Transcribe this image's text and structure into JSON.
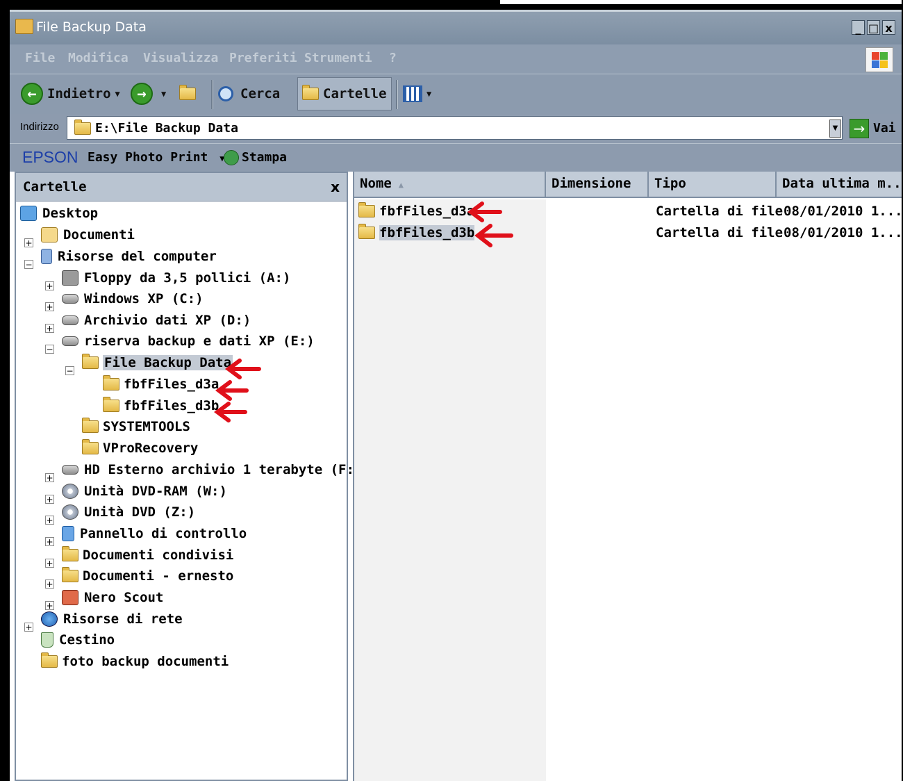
{
  "window": {
    "title": "File Backup Data",
    "min": "_",
    "max": "□",
    "close": "x"
  },
  "menu": [
    "File",
    "Modifica",
    "Visualizza",
    "Preferiti",
    "Strumenti",
    "?"
  ],
  "toolbar": {
    "back": "Indietro",
    "search": "Cerca",
    "folders": "Cartelle"
  },
  "address": {
    "label": "Indirizzo",
    "value": "E:\\File Backup Data",
    "go": "Vai"
  },
  "epson": {
    "logo": "EPSON",
    "easy_print": "Easy Photo Print",
    "print": "Stampa"
  },
  "folders_pane": {
    "title": "Cartelle",
    "close": "x",
    "tree": [
      "Desktop",
      "Documenti",
      "Risorse del computer",
      "Floppy da 3,5 pollici (A:)",
      "Windows XP (C:)",
      "Archivio dati XP (D:)",
      "riserva backup e dati XP (E:)",
      "File Backup Data",
      "fbfFiles_d3a",
      "fbfFiles_d3b",
      "SYSTEMTOOLS",
      "VProRecovery",
      "HD Esterno archivio 1 terabyte (F:)",
      "Unità DVD-RAM (W:)",
      "Unità DVD (Z:)",
      "Pannello di controllo",
      "Documenti condivisi",
      "Documenti - ernesto",
      "Nero Scout",
      "Risorse di rete",
      "Cestino",
      "foto backup documenti"
    ]
  },
  "columns": {
    "name": "Nome",
    "size": "Dimensione",
    "type": "Tipo",
    "date": "Data ultima m..."
  },
  "files": [
    {
      "name": "fbfFiles_d3a",
      "type": "Cartella di file",
      "date": "08/01/2010 1..."
    },
    {
      "name": "fbfFiles_d3b",
      "type": "Cartella di file",
      "date": "08/01/2010 1..."
    }
  ],
  "colors": {
    "annotation_arrow": "#e0101a",
    "chrome": "#8d9bae",
    "selection": "#c3cad4"
  }
}
